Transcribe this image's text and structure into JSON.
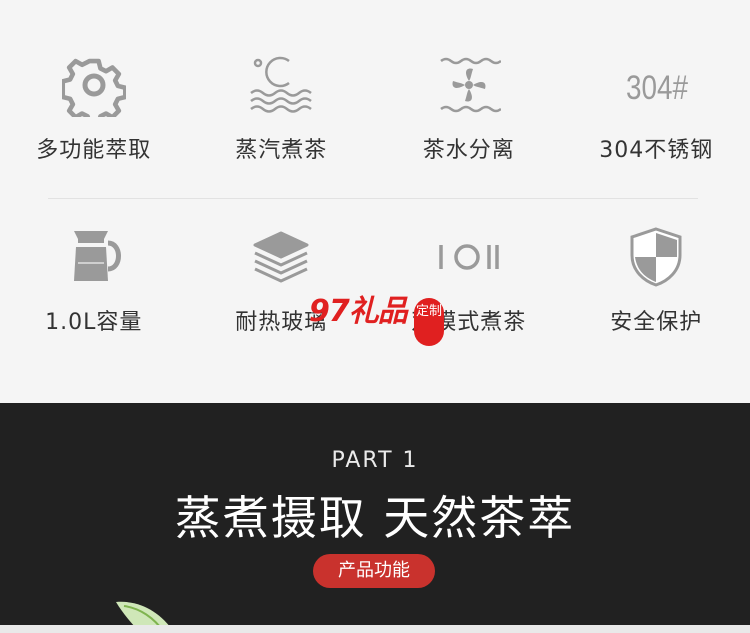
{
  "features": {
    "row1": [
      {
        "icon": "gear-icon",
        "label": "多功能萃取"
      },
      {
        "icon": "steam-celsius-icon",
        "label": "蒸汽煮茶"
      },
      {
        "icon": "water-separation-icon",
        "label": "茶水分离"
      },
      {
        "icon": "304-steel-icon",
        "label": "304不锈钢",
        "icon_text": "304#"
      }
    ],
    "row2": [
      {
        "icon": "kettle-icon",
        "label": "1.0L容量"
      },
      {
        "icon": "glass-layers-icon",
        "label": "耐热玻璃"
      },
      {
        "icon": "mode-switch-icon",
        "label": "双模式煮茶"
      },
      {
        "icon": "shield-icon",
        "label": "安全保护"
      }
    ]
  },
  "watermark": {
    "text": "97礼品",
    "stamp": "定制"
  },
  "banner": {
    "part": "PART 1",
    "headline": "蒸煮摄取 天然茶萃",
    "pill": "产品功能"
  },
  "colors": {
    "accent": "#c9322d",
    "band": "#212121",
    "icon": "#9a9a9a"
  }
}
